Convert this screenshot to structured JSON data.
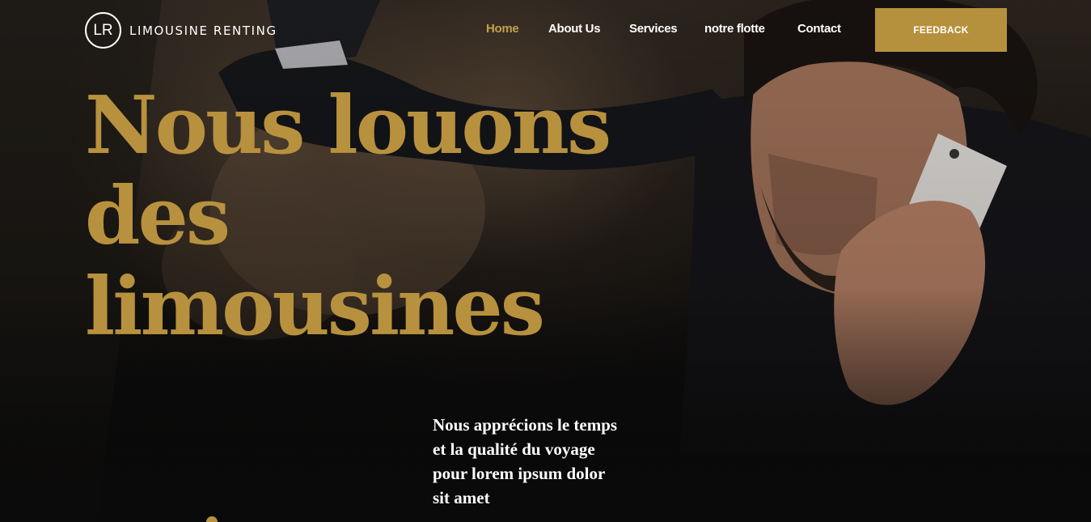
{
  "brand": {
    "monogram": "LR",
    "name": "LIMOUSINE RENTING"
  },
  "nav": {
    "items": [
      {
        "label": "Home",
        "active": true
      },
      {
        "label": "About Us",
        "active": false
      },
      {
        "label": "Services",
        "active": false
      },
      {
        "label": "notre flotte",
        "active": false
      },
      {
        "label": "Contact",
        "active": false
      }
    ],
    "cta_label": "FEEDBACK"
  },
  "hero": {
    "headline_lines": [
      "Nous louons",
      "des",
      "limousines"
    ],
    "tagline_lines": [
      "Nous apprécions le temps",
      "et la qualité du voyage",
      "pour lorem ipsum dolor",
      "sit amet"
    ],
    "image": "man-on-phone-in-limousine"
  },
  "colors": {
    "accent": "#b6913d",
    "active_nav": "#c2a04b",
    "background": "#0d0c0c",
    "text": "#ffffff"
  }
}
